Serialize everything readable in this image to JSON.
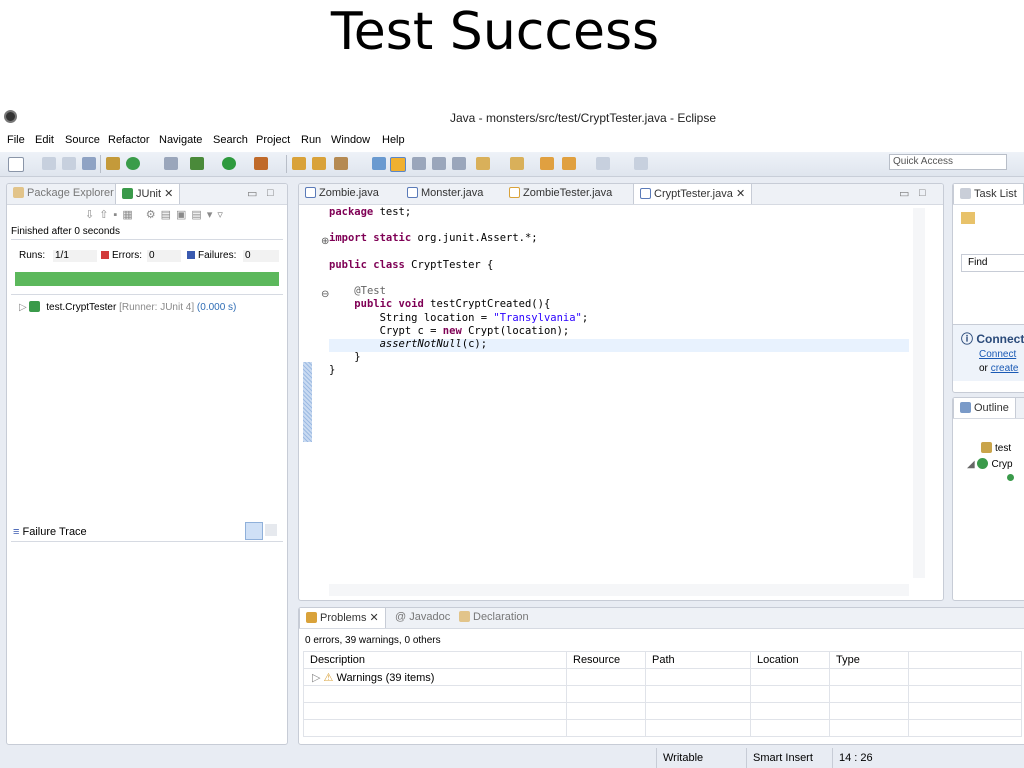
{
  "slide": {
    "title": "Test Success"
  },
  "window": {
    "title": "Java - monsters/src/test/CryptTester.java - Eclipse"
  },
  "menu": [
    "File",
    "Edit",
    "Source",
    "Refactor",
    "Navigate",
    "Search",
    "Project",
    "Run",
    "Window",
    "Help"
  ],
  "quick_access": {
    "placeholder": "Quick Access"
  },
  "left_panel": {
    "tabs": [
      "Package Explorer",
      "JUnit"
    ],
    "finished": "Finished after 0 seconds",
    "runs_label": "Runs:",
    "runs_value": "1/1",
    "errors_label": "Errors:",
    "errors_value": "0",
    "failures_label": "Failures:",
    "failures_value": "0",
    "progress": 1.0,
    "progress_color": "#5cb85c",
    "test_name": "test.CryptTester",
    "runner": "[Runner: JUnit 4]",
    "time": "(0.000 s)",
    "failure_trace": "Failure Trace"
  },
  "editor": {
    "tabs": [
      "Zombie.java",
      "Monster.java",
      "ZombieTester.java",
      "CryptTester.java"
    ],
    "active_tab": "CryptTester.java",
    "lines": {
      "l1": "package test;",
      "l2_kw": "import static",
      "l2_rest": " org.junit.Assert.*;",
      "l3_kw": "public class",
      "l3_rest": " CryptTester {",
      "l4": "@Test",
      "l5_kw": "public void",
      "l5_rest": " testCryptCreated(){",
      "l6_a": "String location = ",
      "l6_str": "\"Transylvania\"",
      "l6_b": ";",
      "l7_a": "Crypt c = ",
      "l7_kw": "new",
      "l7_b": " Crypt(location);",
      "l8_it": "assertNotNull",
      "l8_b": "(c);",
      "l9": "}",
      "l10": "}"
    }
  },
  "right_panel": {
    "task_list": "Task List",
    "find": "Find",
    "connect": "Connect",
    "connect_link": "Connect",
    "or_text": "or",
    "create_link": "create",
    "outline": "Outline",
    "outline_item1": "test",
    "outline_item2": "Cryp"
  },
  "problems": {
    "tabs": [
      "Problems",
      "Javadoc",
      "Declaration"
    ],
    "summary": "0 errors, 39 warnings, 0 others",
    "columns": [
      "Description",
      "Resource",
      "Path",
      "Location",
      "Type"
    ],
    "rows": [
      [
        "Warnings (39 items)",
        "",
        "",
        "",
        ""
      ]
    ]
  },
  "statusbar": {
    "writable": "Writable",
    "insert": "Smart Insert",
    "position": "14 : 26"
  }
}
